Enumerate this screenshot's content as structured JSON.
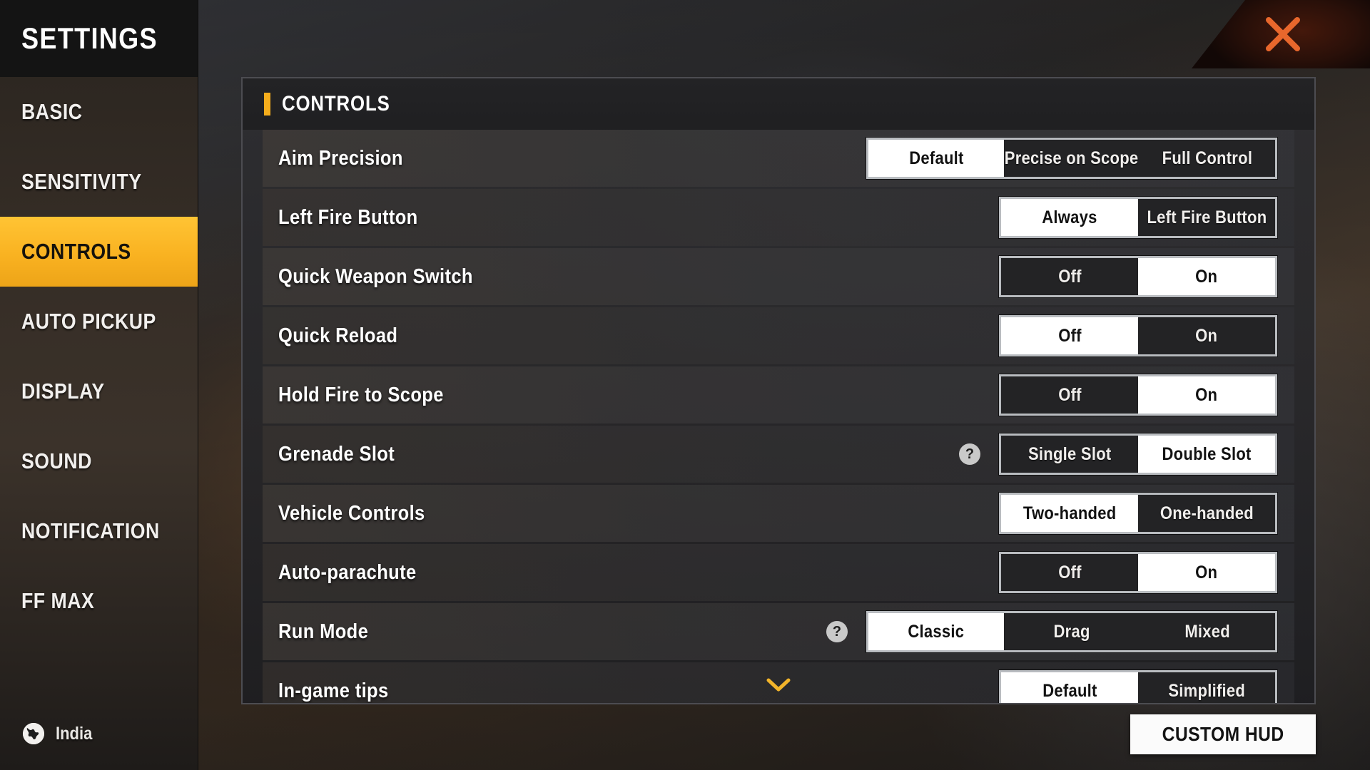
{
  "window": {
    "brand_title": "SETTINGS",
    "close_label": "close"
  },
  "sidebar": {
    "items": [
      {
        "label": "BASIC",
        "active": false
      },
      {
        "label": "SENSITIVITY",
        "active": false
      },
      {
        "label": "CONTROLS",
        "active": true
      },
      {
        "label": "AUTO PICKUP",
        "active": false
      },
      {
        "label": "DISPLAY",
        "active": false
      },
      {
        "label": "SOUND",
        "active": false
      },
      {
        "label": "NOTIFICATION",
        "active": false
      },
      {
        "label": "FF MAX",
        "active": false
      }
    ],
    "locale": {
      "icon": "globe-icon",
      "label": "India"
    }
  },
  "panel": {
    "title": "CONTROLS",
    "accent_color": "#f5ad1c",
    "rows": [
      {
        "label": "Aim Precision",
        "help": false,
        "options": [
          "Default",
          "Precise on Scope",
          "Full Control"
        ],
        "selected": "Default"
      },
      {
        "label": "Left Fire Button",
        "help": false,
        "options": [
          "Always",
          "Left Fire Button"
        ],
        "selected": "Always"
      },
      {
        "label": "Quick Weapon Switch",
        "help": false,
        "options": [
          "Off",
          "On"
        ],
        "selected": "On"
      },
      {
        "label": "Quick Reload",
        "help": false,
        "options": [
          "Off",
          "On"
        ],
        "selected": "Off"
      },
      {
        "label": "Hold Fire to Scope",
        "help": false,
        "options": [
          "Off",
          "On"
        ],
        "selected": "On"
      },
      {
        "label": "Grenade Slot",
        "help": true,
        "options": [
          "Single Slot",
          "Double Slot"
        ],
        "selected": "Double Slot"
      },
      {
        "label": "Vehicle Controls",
        "help": false,
        "options": [
          "Two-handed",
          "One-handed"
        ],
        "selected": "Two-handed"
      },
      {
        "label": "Auto-parachute",
        "help": false,
        "options": [
          "Off",
          "On"
        ],
        "selected": "On"
      },
      {
        "label": "Run Mode",
        "help": true,
        "options": [
          "Classic",
          "Drag",
          "Mixed"
        ],
        "selected": "Classic"
      },
      {
        "label": "In-game tips",
        "help": false,
        "options": [
          "Default",
          "Simplified"
        ],
        "selected": "Default"
      }
    ],
    "scroll_hint_icon": "chevron-down-icon"
  },
  "footer": {
    "custom_hud_label": "CUSTOM HUD"
  },
  "colors": {
    "accent": "#f5ad1c",
    "active_nav": "#f9b221",
    "close_x": "#e8672c",
    "selected_segment_bg": "#ffffff"
  }
}
